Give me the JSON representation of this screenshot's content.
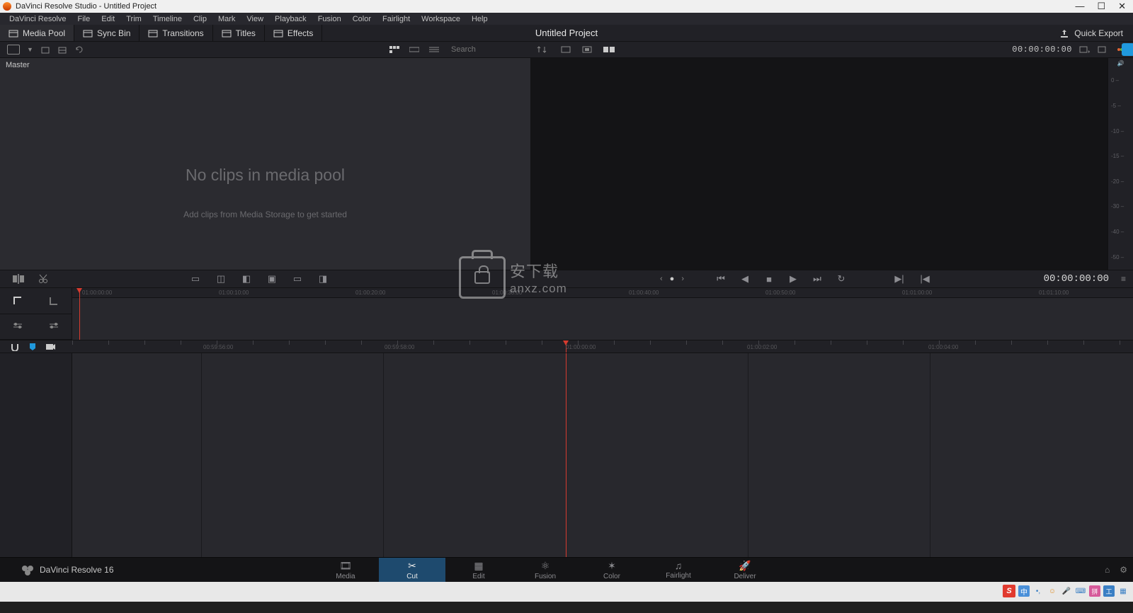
{
  "titlebar": {
    "text": "DaVinci Resolve Studio - Untitled Project"
  },
  "menu": [
    "DaVinci Resolve",
    "File",
    "Edit",
    "Trim",
    "Timeline",
    "Clip",
    "Mark",
    "View",
    "Playback",
    "Fusion",
    "Color",
    "Fairlight",
    "Workspace",
    "Help"
  ],
  "toolbar": {
    "tabs": [
      {
        "id": "media-pool",
        "label": "Media Pool",
        "active": true
      },
      {
        "id": "sync-bin",
        "label": "Sync Bin",
        "active": false
      },
      {
        "id": "transitions",
        "label": "Transitions",
        "active": false
      },
      {
        "id": "titles",
        "label": "Titles",
        "active": false
      },
      {
        "id": "effects",
        "label": "Effects",
        "active": false
      }
    ],
    "center_title": "Untitled Project",
    "quick_export": "Quick Export"
  },
  "subtoolbar": {
    "search_placeholder": "Search",
    "right_timecode": "00:00:00:00"
  },
  "pool": {
    "folder": "Master",
    "empty_heading": "No clips in media pool",
    "empty_sub": "Add clips from Media Storage to get started"
  },
  "meter_ticks": [
    "0",
    "-5",
    "-10",
    "-15",
    "-20",
    "-30",
    "-40",
    "-50"
  ],
  "playbar": {
    "timecode": "00:00:00:00"
  },
  "ruler_upper": [
    "01:00:00:00",
    "01:00:10:00",
    "01:00:20:00",
    "01:00:30:00",
    "01:00:40:00",
    "01:00:50:00",
    "01:01:00:00",
    "01:01:10:00"
  ],
  "ruler_lower": [
    "00:59:56:00",
    "00:59:58:00",
    "01:00:00:00",
    "01:00:02:00",
    "01:00:04:00"
  ],
  "pages": [
    {
      "id": "media",
      "label": "Media",
      "glyph": "🎞"
    },
    {
      "id": "cut",
      "label": "Cut",
      "glyph": "✂",
      "active": true
    },
    {
      "id": "edit",
      "label": "Edit",
      "glyph": "▦"
    },
    {
      "id": "fusion",
      "label": "Fusion",
      "glyph": "⚛"
    },
    {
      "id": "color",
      "label": "Color",
      "glyph": "✶"
    },
    {
      "id": "fairlight",
      "label": "Fairlight",
      "glyph": "♫"
    },
    {
      "id": "deliver",
      "label": "Deliver",
      "glyph": "🚀"
    }
  ],
  "brand": "DaVinci Resolve 16",
  "watermark": {
    "chinese": "安下载",
    "domain": "anxz.com"
  },
  "tray": {
    "ime": "中"
  }
}
